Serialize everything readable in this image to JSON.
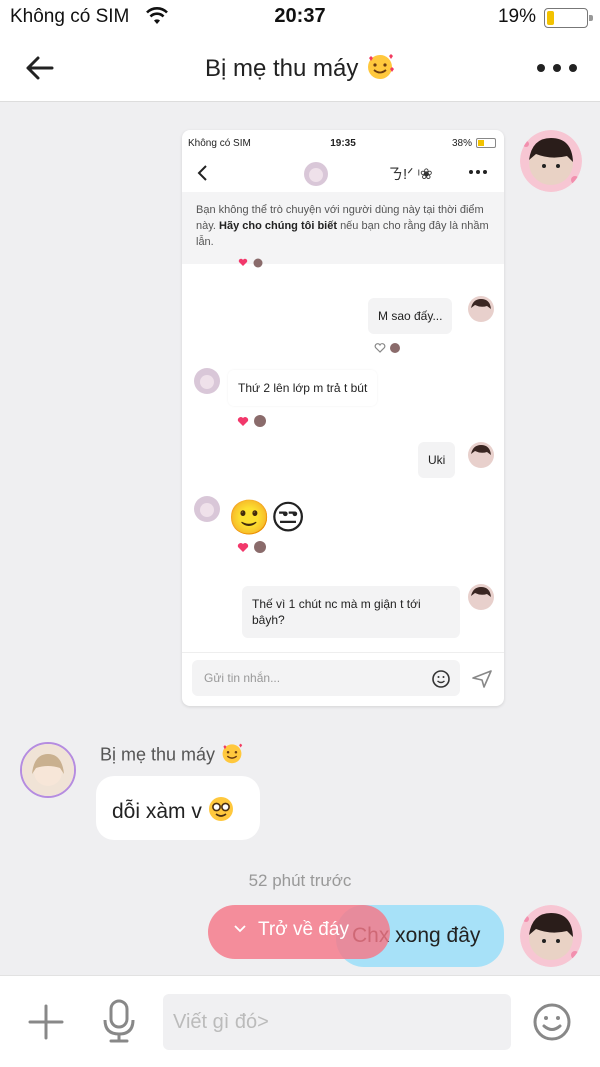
{
  "status_bar": {
    "carrier": "Không có SIM",
    "time": "20:37",
    "battery": "19%",
    "battery_level": 0.19
  },
  "header": {
    "title": "Bị mẹ thu máy"
  },
  "shared_screenshot": {
    "status": {
      "carrier": "Không có SIM",
      "time": "19:35",
      "battery": "38%",
      "battery_level": 0.38
    },
    "header_name": "ㄋ!ᐟ ᶦ❀",
    "notice_text": "Bạn không thể trò chuyện với người dùng này tại thời điểm này.",
    "notice_link": "Hãy cho chúng tôi biết",
    "notice_tail": "nếu bạn cho rằng đây là nhầm lẫn.",
    "messages": [
      {
        "text": "M sao đấy..."
      },
      {
        "text": "Thứ 2 lên lớp m trả t bút"
      },
      {
        "text": "Uki"
      },
      {
        "text": "🙂😒"
      },
      {
        "text": "Thế vì 1 chút nc mà m giận t tới bâyh?"
      }
    ],
    "input_placeholder": "Gửi tin nhắn..."
  },
  "incoming": {
    "sender": "Bị mẹ thu máy",
    "text": "dỗi xàm v"
  },
  "time_label": "52 phút trước",
  "outgoing": {
    "text": "Chx xong đây"
  },
  "jump_button": {
    "label": "Trở về đáy"
  },
  "input_bar": {
    "placeholder": "Viết gì đó>"
  },
  "colors": {
    "outgoing_bubble": "#a7e1f8",
    "jump_button": "#f57887",
    "heart": "#f2386b"
  },
  "icons": [
    "back-arrow-icon",
    "more-dots-icon",
    "plus-icon",
    "mic-icon",
    "smiley-icon",
    "send-icon",
    "heart-icon"
  ]
}
